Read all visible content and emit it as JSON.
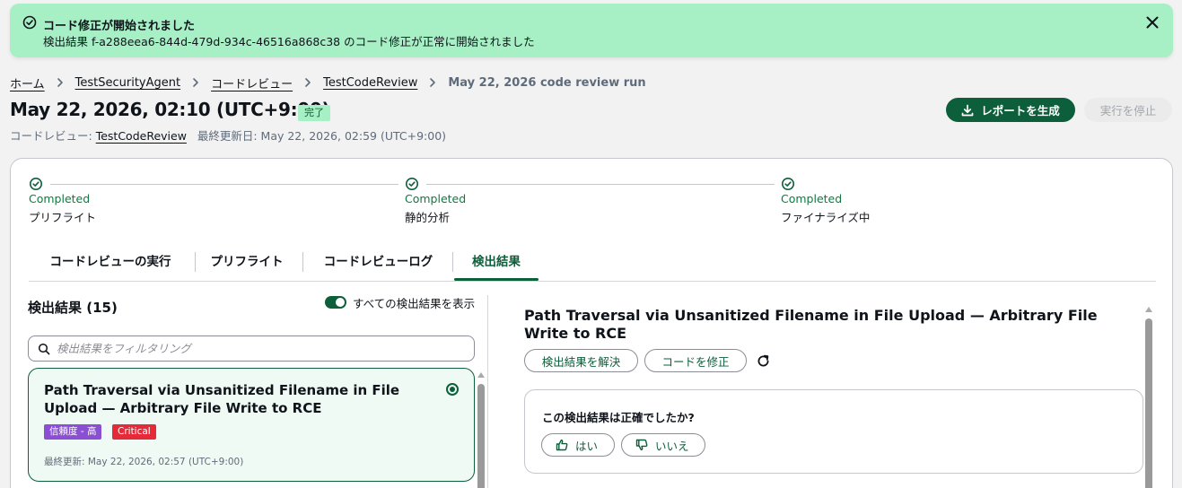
{
  "flash": {
    "title": "コード修正が開始されました",
    "message": "検出結果 f-a288eea6-844d-479d-934c-46516a868c38 のコード修正が正常に開始されました",
    "icons": {
      "status": "check-circle-icon",
      "dismiss": "close-icon"
    }
  },
  "breadcrumb": {
    "items": [
      "ホーム",
      "TestSecurityAgent",
      "コードレビュー",
      "TestCodeReview"
    ],
    "current": "May 22, 2026 code review run"
  },
  "header": {
    "title": "May 22, 2026, 02:10 (UTC+9:00)",
    "status": "完了",
    "subtitle_prefix": "コードレビュー:",
    "subtitle_link": "TestCodeReview",
    "subtitle_updated": "最終更新日: May 22, 2026, 02:59 (UTC+9:00)",
    "generate_report": "レポートを生成",
    "stop_run": "実行を停止"
  },
  "steps": [
    {
      "status": "Completed",
      "name": "プリフライト"
    },
    {
      "status": "Completed",
      "name": "静的分析"
    },
    {
      "status": "Completed",
      "name": "ファイナライズ中"
    }
  ],
  "tabs": [
    {
      "label": "コードレビューの実行",
      "active": false
    },
    {
      "label": "プリフライト",
      "active": false
    },
    {
      "label": "コードレビューログ",
      "active": false
    },
    {
      "label": "検出結果",
      "active": true
    }
  ],
  "findings": {
    "title": "検出結果 (15)",
    "toggle_label": "すべての検出結果を表示",
    "toggle_on": true,
    "filter_placeholder": "検出結果をフィルタリング",
    "filter_value": "",
    "items": [
      {
        "title": "Path Traversal via Unsanitized Filename in File Upload — Arbitrary File Write to RCE",
        "confidence": "信頼度 - 高",
        "severity": "Critical",
        "updated": "最終更新: May 22, 2026, 02:57 (UTC+9:00)",
        "selected": true
      }
    ]
  },
  "detail": {
    "title": "Path Traversal via Unsanitized Filename in File Upload — Arbitrary File Write to RCE",
    "resolve_button": "検出結果を解決",
    "fix_button": "コードを修正",
    "feedback_question": "この検出結果は正確でしたか?",
    "yes": "はい",
    "no": "いいえ"
  },
  "colors": {
    "primary": "#0d5e3a",
    "success_flash": "#a7f0c5",
    "completed_text": "#0d7a3e",
    "confidence_badge": "#8a4fd2",
    "critical_badge": "#e52b3a"
  }
}
